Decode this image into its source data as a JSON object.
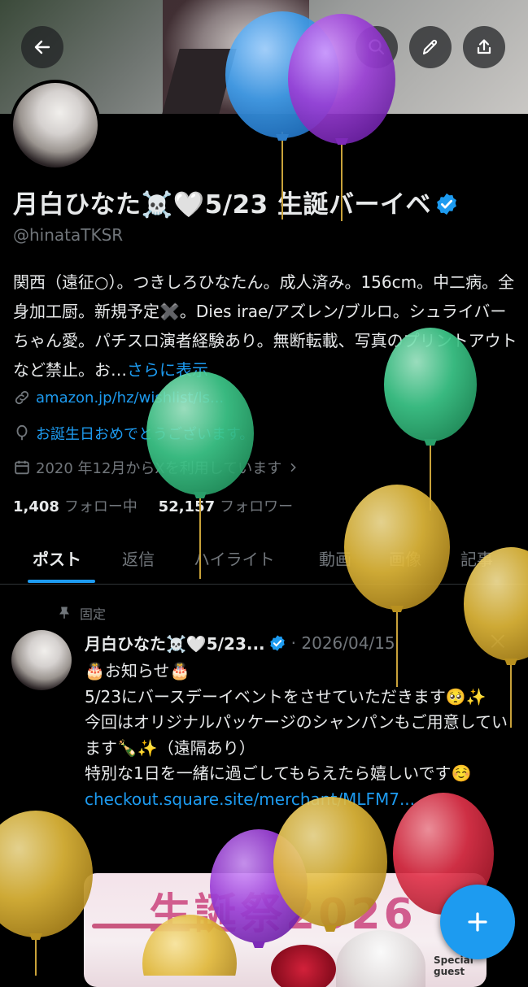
{
  "header": {
    "back_icon": "arrow-left-icon",
    "search_icon": "search-icon",
    "edit_icon": "pencil-icon",
    "share_icon": "share-icon"
  },
  "profile": {
    "name": "月白ひなた☠️🤍5/23 生誕バーイベ",
    "handle": "@hinataTKSR",
    "bio": "関西（遠征○）。つきしろひなたん。成人済み。156cm。中二病。全身加工厨。新規予定✖️。Dies irae/アズレン/ブルロ。シュライバーちゃん愛。パチスロ演者経験あり。無断転載、写真のプリントアウトなど禁止。お…",
    "bio_more": "さらに表示",
    "link": "amazon.jp/hz/wishlist/ls...",
    "birthday": "お誕生日おめでとうございます。",
    "joined": "2020 年12月からXを利用しています",
    "following_count": "1,408",
    "following_label": "フォロー中",
    "followers_count": "52,157",
    "followers_label": "フォロワー"
  },
  "tabs": [
    "ポスト",
    "返信",
    "ハイライト",
    "動画",
    "画像",
    "記事"
  ],
  "post": {
    "pinned_label": "固定",
    "author": "月白ひなた☠️🤍5/23...",
    "date": "· 2026/04/15",
    "lines": [
      "🎂お知らせ🎂",
      "5/23にバースデーイベントをさせていただきます🥺✨",
      "今回はオリジナルパッケージのシャンパンもご用意しています🍾✨（遠隔あり）",
      "特別な1日を一緒に過ごしてもらえたら嬉しいです☺️"
    ],
    "link": "checkout.square.site/merchant/MLFM7...",
    "media_title": "生誕祭2026",
    "media_badge": "Special guest"
  },
  "fab_icon": "plus-icon",
  "colors": {
    "accent": "#1d9bf0",
    "balloon_blue": "#3d9be9",
    "balloon_purple": "#9b3fd6",
    "balloon_green": "#3ec98b",
    "balloon_yellow": "#e0b83a",
    "balloon_red": "#e0334a"
  }
}
